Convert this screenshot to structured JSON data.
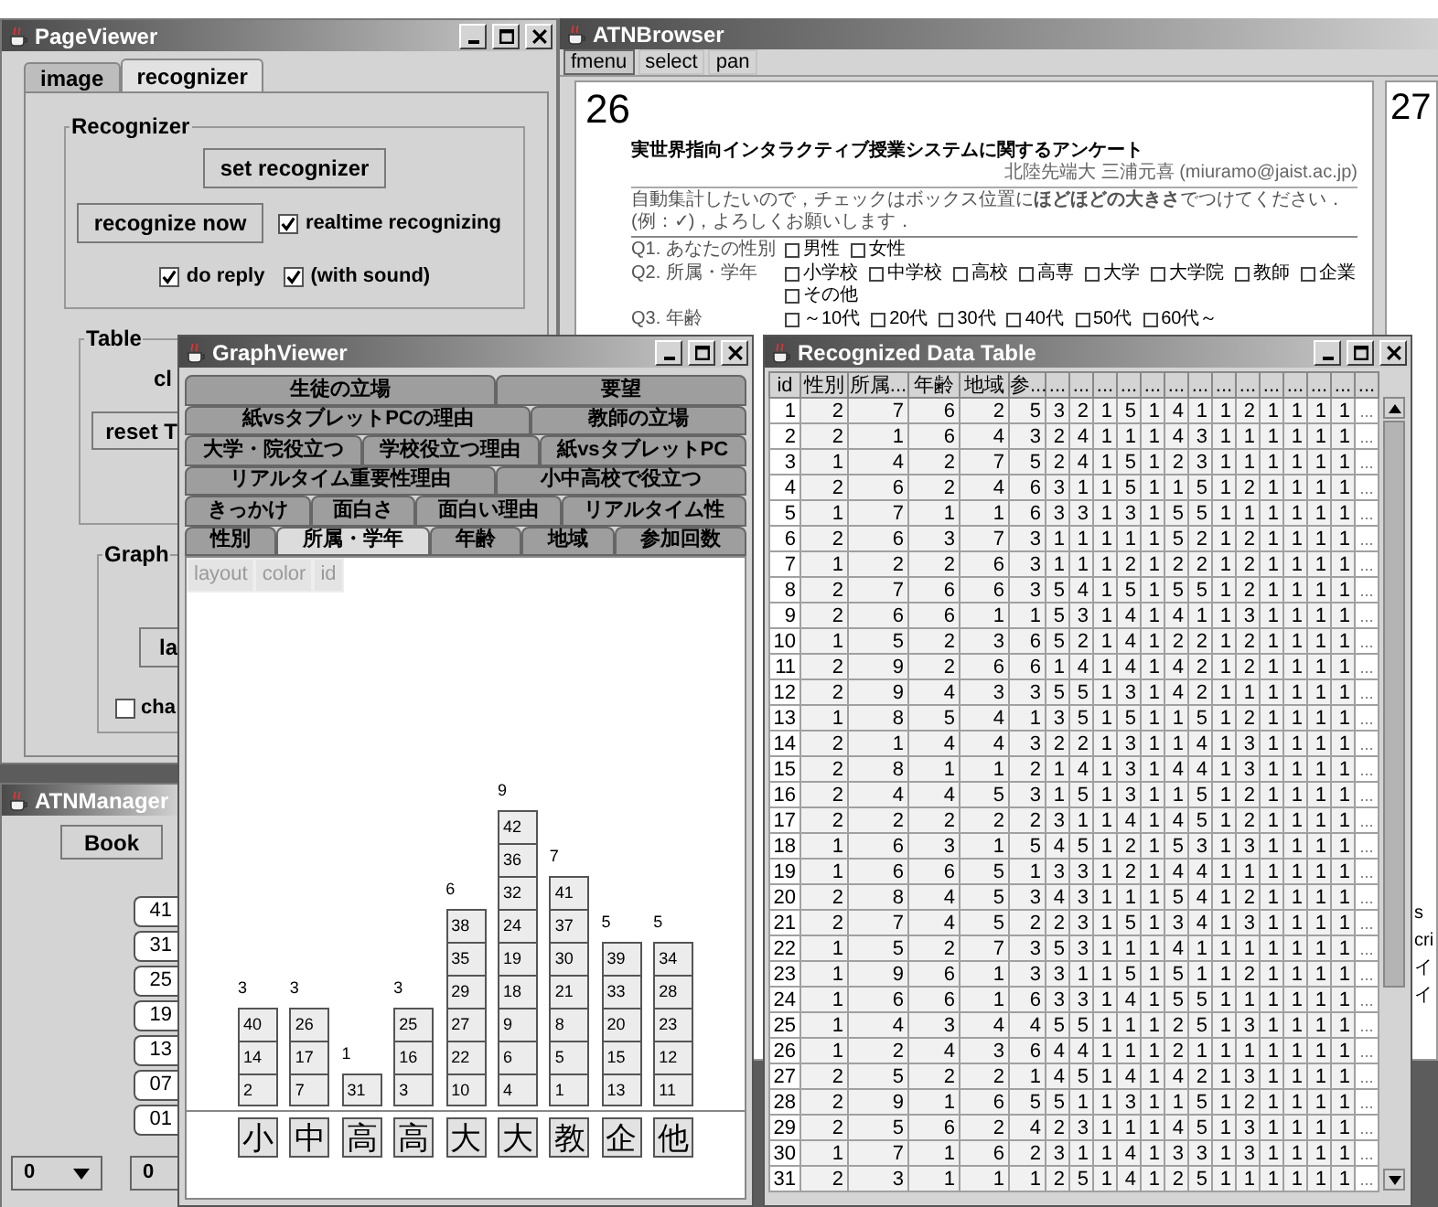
{
  "page_viewer": {
    "title": "PageViewer",
    "tabs": [
      {
        "label": "image",
        "selected": false
      },
      {
        "label": "recognizer",
        "selected": true
      }
    ],
    "recognizer_group": {
      "title": "Recognizer",
      "set_button": "set recognizer",
      "recognize_button": "recognize now",
      "checkboxes": [
        {
          "label": "realtime recognizing",
          "checked": true
        },
        {
          "label": "do reply",
          "checked": true
        },
        {
          "label": "(with sound)",
          "checked": true
        }
      ]
    },
    "table_group": {
      "title": "Table",
      "label": "cl",
      "button": "reset T"
    },
    "graph_group": {
      "title": "Graph",
      "button": "la",
      "checkbox": {
        "label": "cha",
        "checked": false
      }
    }
  },
  "atn_manager": {
    "title": "ATNManager",
    "book_button": "Book",
    "page_buttons": [
      "41",
      "31",
      "25",
      "19",
      "13",
      "07",
      "01"
    ],
    "dropdowns": [
      "0",
      "0"
    ]
  },
  "atn_browser": {
    "title": "ATNBrowser",
    "menu": [
      {
        "label": "fmenu",
        "selected": true
      },
      {
        "label": "select",
        "selected": false
      },
      {
        "label": "pan",
        "selected": false
      }
    ],
    "pages": [
      {
        "number": "26",
        "document": {
          "title": "実世界指向インタラクティブ授業システムに関するアンケート",
          "author": "北陸先端大 三浦元喜 (miuramo@jaist.ac.jp)",
          "instructions": "自動集計したいので，チェックはボックス位置に**ほどほどの大きさ**でつけてください．(例：✓)，よろしくお願いします．",
          "questions": [
            {
              "label": "Q1. あなたの性別",
              "options": [
                "男性",
                "女性"
              ]
            },
            {
              "label": "Q2. 所属・学年",
              "options": [
                "小学校",
                "中学校",
                "高校",
                "高専",
                "大学",
                "大学院",
                "教師",
                "企業",
                "その他"
              ]
            },
            {
              "label": "Q3. 年齢",
              "options": [
                "～10代",
                "20代",
                "30代",
                "40代",
                "50代",
                "60代～"
              ]
            }
          ]
        }
      },
      {
        "number": "27",
        "fragments": [
          "s",
          "cri",
          "イ",
          "イ"
        ]
      }
    ]
  },
  "graph_viewer": {
    "title": "GraphViewer",
    "tab_rows": [
      [
        {
          "label": "生徒の立場",
          "selected": false
        },
        {
          "label": "要望",
          "selected": false
        }
      ],
      [
        {
          "label": "紙vsタブレットPCの理由",
          "selected": false
        },
        {
          "label": "教師の立場",
          "selected": false
        }
      ],
      [
        {
          "label": "大学・院役立つ",
          "selected": false
        },
        {
          "label": "学校役立つ理由",
          "selected": false
        },
        {
          "label": "紙vsタブレットPC",
          "selected": false
        }
      ],
      [
        {
          "label": "リアルタイム重要性理由",
          "selected": false
        },
        {
          "label": "小中高校で役立つ",
          "selected": false
        }
      ],
      [
        {
          "label": "きっかけ",
          "selected": false
        },
        {
          "label": "面白さ",
          "selected": false
        },
        {
          "label": "面白い理由",
          "selected": false
        },
        {
          "label": "リアルタイム性",
          "selected": false
        }
      ],
      [
        {
          "label": "性別",
          "selected": false
        },
        {
          "label": "所属・学年",
          "selected": true
        },
        {
          "label": "年齢",
          "selected": false
        },
        {
          "label": "地域",
          "selected": false
        },
        {
          "label": "参加回数",
          "selected": false
        }
      ]
    ],
    "view_buttons": [
      "layout",
      "color",
      "id"
    ],
    "stacks": [
      {
        "label": "小",
        "count": "3",
        "ids": [
          "40",
          "14",
          "2"
        ]
      },
      {
        "label": "中",
        "count": "3",
        "ids": [
          "26",
          "17",
          "7"
        ]
      },
      {
        "label": "高",
        "count": "1",
        "ids": [
          "31"
        ]
      },
      {
        "label": "高",
        "count": "3",
        "ids": [
          "25",
          "16",
          "3"
        ]
      },
      {
        "label": "大",
        "count": "6",
        "ids": [
          "38",
          "35",
          "29",
          "27",
          "22",
          "10"
        ]
      },
      {
        "label": "大",
        "count": "9",
        "ids": [
          "42",
          "36",
          "32",
          "24",
          "19",
          "18",
          "9",
          "6",
          "4"
        ]
      },
      {
        "label": "教",
        "count": "7",
        "ids": [
          "41",
          "37",
          "30",
          "21",
          "8",
          "5",
          "1"
        ]
      },
      {
        "label": "企",
        "count": "5",
        "ids": [
          "39",
          "33",
          "20",
          "15",
          "13"
        ]
      },
      {
        "label": "他",
        "count": "5",
        "ids": [
          "34",
          "28",
          "23",
          "12",
          "11"
        ]
      }
    ]
  },
  "data_table": {
    "title": "Recognized Data Table",
    "columns": [
      "id",
      "性別",
      "所属...",
      "年齢",
      "地域",
      "参...",
      "...",
      "...",
      "...",
      "...",
      "...",
      "...",
      "...",
      "...",
      "...",
      "...",
      "...",
      "...",
      "...",
      "..."
    ],
    "rows": [
      [
        "1",
        "2",
        "7",
        "6",
        "2",
        "5",
        "3",
        "2",
        "1",
        "5",
        "1",
        "4",
        "1",
        "1",
        "2",
        "1",
        "1",
        "1",
        "1",
        "..."
      ],
      [
        "2",
        "2",
        "1",
        "6",
        "4",
        "3",
        "2",
        "4",
        "1",
        "1",
        "1",
        "4",
        "3",
        "1",
        "1",
        "1",
        "1",
        "1",
        "1",
        "..."
      ],
      [
        "3",
        "1",
        "4",
        "2",
        "7",
        "5",
        "2",
        "4",
        "1",
        "5",
        "1",
        "2",
        "3",
        "1",
        "1",
        "1",
        "1",
        "1",
        "1",
        "..."
      ],
      [
        "4",
        "2",
        "6",
        "2",
        "4",
        "6",
        "3",
        "1",
        "1",
        "5",
        "1",
        "1",
        "5",
        "1",
        "2",
        "1",
        "1",
        "1",
        "1",
        "..."
      ],
      [
        "5",
        "1",
        "7",
        "1",
        "1",
        "6",
        "3",
        "3",
        "1",
        "3",
        "1",
        "5",
        "5",
        "1",
        "1",
        "1",
        "1",
        "1",
        "1",
        "..."
      ],
      [
        "6",
        "2",
        "6",
        "3",
        "7",
        "3",
        "1",
        "1",
        "1",
        "1",
        "1",
        "5",
        "2",
        "1",
        "2",
        "1",
        "1",
        "1",
        "1",
        "..."
      ],
      [
        "7",
        "1",
        "2",
        "2",
        "6",
        "3",
        "1",
        "1",
        "1",
        "2",
        "1",
        "2",
        "2",
        "1",
        "2",
        "1",
        "1",
        "1",
        "1",
        "..."
      ],
      [
        "8",
        "2",
        "7",
        "6",
        "6",
        "3",
        "5",
        "4",
        "1",
        "5",
        "1",
        "5",
        "5",
        "1",
        "2",
        "1",
        "1",
        "1",
        "1",
        "..."
      ],
      [
        "9",
        "2",
        "6",
        "6",
        "1",
        "1",
        "5",
        "3",
        "1",
        "4",
        "1",
        "4",
        "1",
        "1",
        "3",
        "1",
        "1",
        "1",
        "1",
        "..."
      ],
      [
        "10",
        "1",
        "5",
        "2",
        "3",
        "6",
        "5",
        "2",
        "1",
        "4",
        "1",
        "2",
        "2",
        "1",
        "2",
        "1",
        "1",
        "1",
        "1",
        "..."
      ],
      [
        "11",
        "2",
        "9",
        "2",
        "6",
        "6",
        "1",
        "4",
        "1",
        "4",
        "1",
        "4",
        "2",
        "1",
        "2",
        "1",
        "1",
        "1",
        "1",
        "..."
      ],
      [
        "12",
        "2",
        "9",
        "4",
        "3",
        "3",
        "5",
        "5",
        "1",
        "3",
        "1",
        "4",
        "2",
        "1",
        "1",
        "1",
        "1",
        "1",
        "1",
        "..."
      ],
      [
        "13",
        "1",
        "8",
        "5",
        "4",
        "1",
        "3",
        "5",
        "1",
        "5",
        "1",
        "1",
        "5",
        "1",
        "2",
        "1",
        "1",
        "1",
        "1",
        "..."
      ],
      [
        "14",
        "2",
        "1",
        "4",
        "4",
        "3",
        "2",
        "2",
        "1",
        "3",
        "1",
        "1",
        "4",
        "1",
        "3",
        "1",
        "1",
        "1",
        "1",
        "..."
      ],
      [
        "15",
        "2",
        "8",
        "1",
        "1",
        "2",
        "1",
        "4",
        "1",
        "3",
        "1",
        "4",
        "4",
        "1",
        "3",
        "1",
        "1",
        "1",
        "1",
        "..."
      ],
      [
        "16",
        "2",
        "4",
        "4",
        "5",
        "3",
        "1",
        "5",
        "1",
        "3",
        "1",
        "1",
        "5",
        "1",
        "2",
        "1",
        "1",
        "1",
        "1",
        "..."
      ],
      [
        "17",
        "2",
        "2",
        "2",
        "2",
        "2",
        "3",
        "1",
        "1",
        "4",
        "1",
        "4",
        "5",
        "1",
        "2",
        "1",
        "1",
        "1",
        "1",
        "..."
      ],
      [
        "18",
        "1",
        "6",
        "3",
        "1",
        "5",
        "4",
        "5",
        "1",
        "2",
        "1",
        "5",
        "3",
        "1",
        "3",
        "1",
        "1",
        "1",
        "1",
        "..."
      ],
      [
        "19",
        "1",
        "6",
        "6",
        "5",
        "1",
        "3",
        "3",
        "1",
        "2",
        "1",
        "4",
        "4",
        "1",
        "1",
        "1",
        "1",
        "1",
        "1",
        "..."
      ],
      [
        "20",
        "2",
        "8",
        "4",
        "5",
        "3",
        "4",
        "3",
        "1",
        "1",
        "1",
        "5",
        "4",
        "1",
        "2",
        "1",
        "1",
        "1",
        "1",
        "..."
      ],
      [
        "21",
        "2",
        "7",
        "4",
        "5",
        "2",
        "2",
        "3",
        "1",
        "5",
        "1",
        "3",
        "4",
        "1",
        "3",
        "1",
        "1",
        "1",
        "1",
        "..."
      ],
      [
        "22",
        "1",
        "5",
        "2",
        "7",
        "3",
        "5",
        "3",
        "1",
        "1",
        "1",
        "4",
        "1",
        "1",
        "1",
        "1",
        "1",
        "1",
        "1",
        "..."
      ],
      [
        "23",
        "1",
        "9",
        "6",
        "1",
        "3",
        "3",
        "1",
        "1",
        "5",
        "1",
        "5",
        "1",
        "1",
        "2",
        "1",
        "1",
        "1",
        "1",
        "..."
      ],
      [
        "24",
        "1",
        "6",
        "6",
        "1",
        "6",
        "3",
        "3",
        "1",
        "4",
        "1",
        "5",
        "5",
        "1",
        "1",
        "1",
        "1",
        "1",
        "1",
        "..."
      ],
      [
        "25",
        "1",
        "4",
        "3",
        "4",
        "4",
        "5",
        "5",
        "1",
        "1",
        "1",
        "2",
        "5",
        "1",
        "3",
        "1",
        "1",
        "1",
        "1",
        "..."
      ],
      [
        "26",
        "1",
        "2",
        "4",
        "3",
        "6",
        "4",
        "4",
        "1",
        "1",
        "1",
        "2",
        "1",
        "1",
        "1",
        "1",
        "1",
        "1",
        "1",
        "..."
      ],
      [
        "27",
        "2",
        "5",
        "2",
        "2",
        "1",
        "4",
        "5",
        "1",
        "4",
        "1",
        "4",
        "2",
        "1",
        "3",
        "1",
        "1",
        "1",
        "1",
        "..."
      ],
      [
        "28",
        "2",
        "9",
        "1",
        "6",
        "5",
        "5",
        "1",
        "1",
        "3",
        "1",
        "1",
        "5",
        "1",
        "2",
        "1",
        "1",
        "1",
        "1",
        "..."
      ],
      [
        "29",
        "2",
        "5",
        "6",
        "2",
        "4",
        "2",
        "3",
        "1",
        "1",
        "1",
        "4",
        "5",
        "1",
        "3",
        "1",
        "1",
        "1",
        "1",
        "..."
      ],
      [
        "30",
        "1",
        "7",
        "1",
        "6",
        "2",
        "3",
        "1",
        "1",
        "4",
        "1",
        "3",
        "3",
        "1",
        "3",
        "1",
        "1",
        "1",
        "1",
        "..."
      ],
      [
        "31",
        "2",
        "3",
        "1",
        "1",
        "1",
        "2",
        "5",
        "1",
        "4",
        "1",
        "2",
        "5",
        "1",
        "1",
        "1",
        "1",
        "1",
        "1",
        "..."
      ]
    ]
  }
}
